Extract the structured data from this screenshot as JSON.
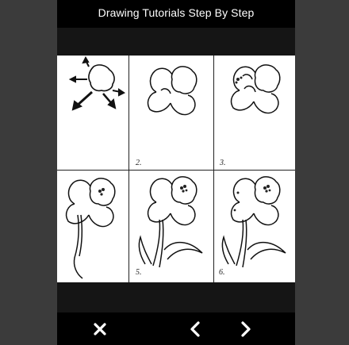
{
  "app": {
    "title": "Drawing Tutorials Step By Step"
  },
  "steps": [
    {
      "label": ""
    },
    {
      "label": "2."
    },
    {
      "label": "3."
    },
    {
      "label": ""
    },
    {
      "label": "5."
    },
    {
      "label": "6."
    }
  ],
  "toolbar": {
    "close_icon": "close-icon",
    "prev_icon": "chevron-left-icon",
    "next_icon": "chevron-right-icon"
  }
}
